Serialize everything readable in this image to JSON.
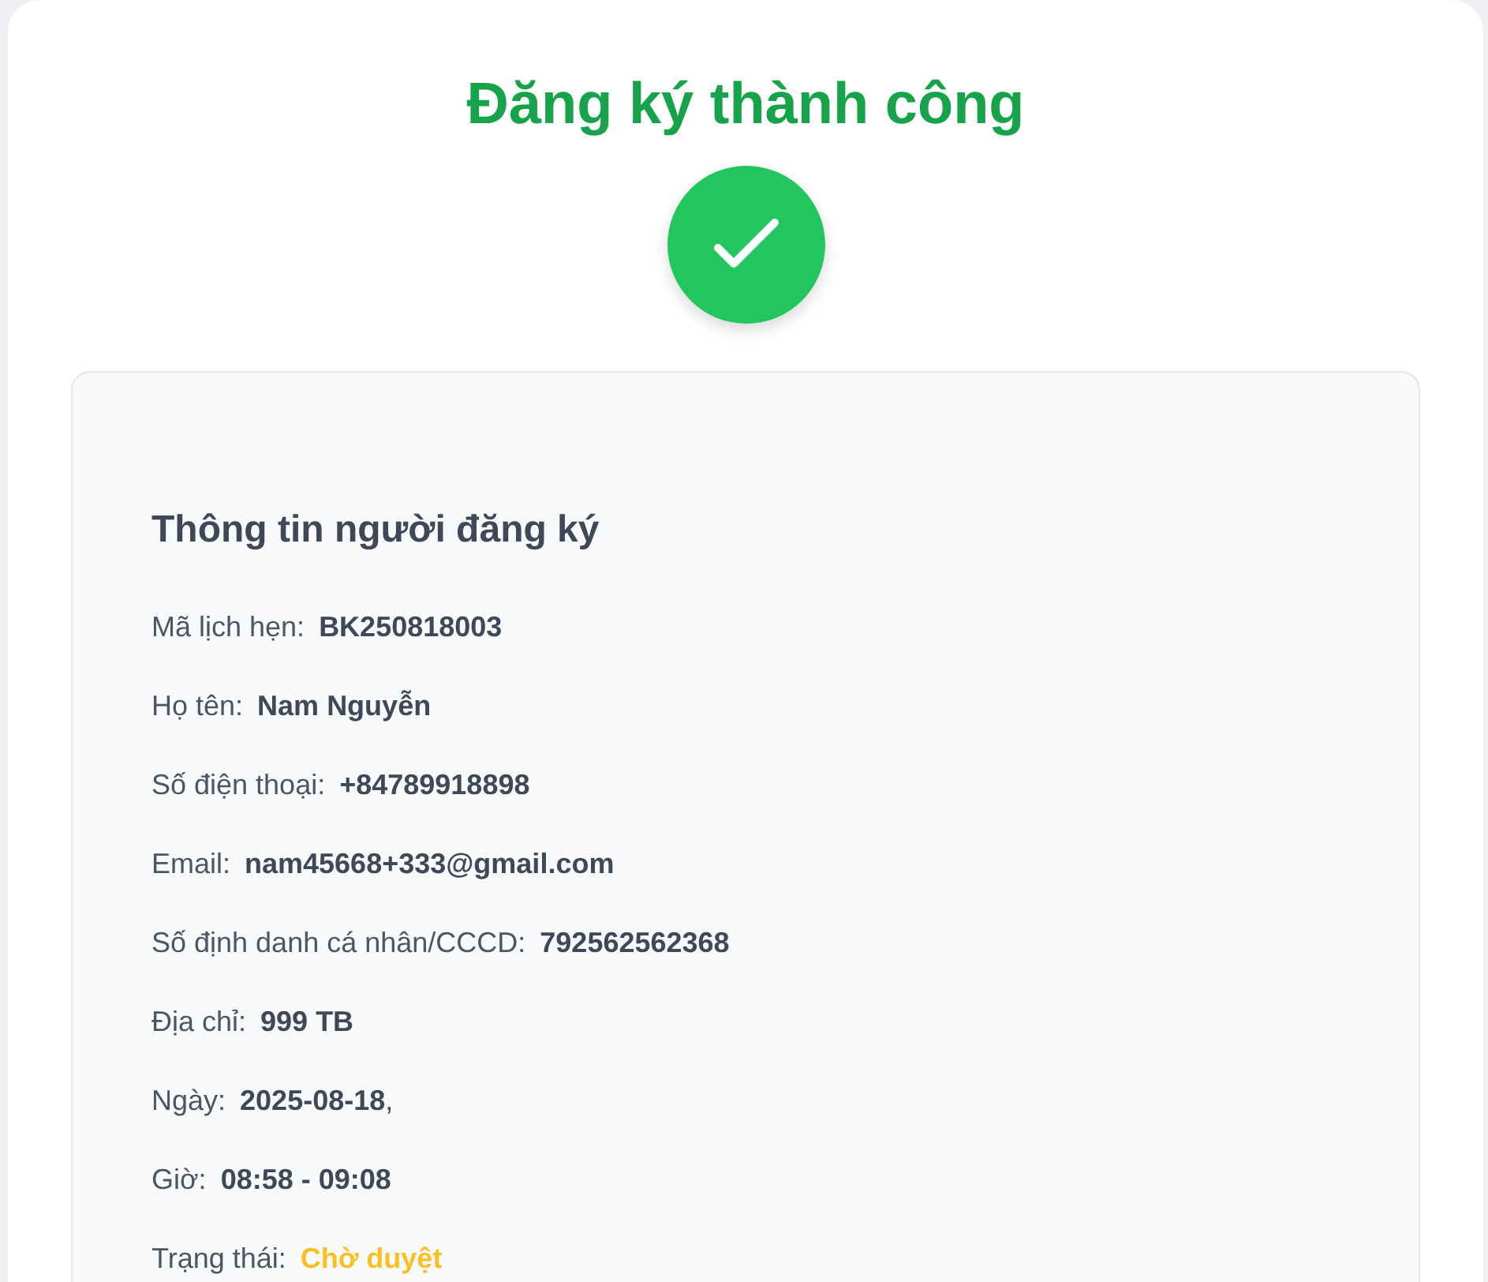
{
  "title": "Đăng ký thành công",
  "details": {
    "heading": "Thông tin người đăng ký",
    "rows": [
      {
        "kind": "text",
        "label": "Mã lịch hẹn:",
        "value": "BK250818003"
      },
      {
        "kind": "text",
        "label": "Họ tên:",
        "value": "Nam Nguyễn"
      },
      {
        "kind": "text",
        "label": "Số điện thoại:",
        "value": "+84789918898"
      },
      {
        "kind": "text",
        "label": "Email:",
        "value": "nam45668+333@gmail.com"
      },
      {
        "kind": "text",
        "label": "Số định danh cá nhân/CCCD:",
        "value": "792562562368"
      },
      {
        "kind": "text",
        "label": "Địa chỉ:",
        "value": "999 TB"
      },
      {
        "kind": "text",
        "label": "Ngày:",
        "value": "2025-08-18",
        "suffix": ","
      },
      {
        "kind": "text",
        "label": "Giờ:",
        "value": "08:58 - 09:08"
      },
      {
        "kind": "status",
        "label": "Trạng thái:",
        "value": "Chờ duyệt",
        "color": "#fbbf24"
      }
    ]
  }
}
